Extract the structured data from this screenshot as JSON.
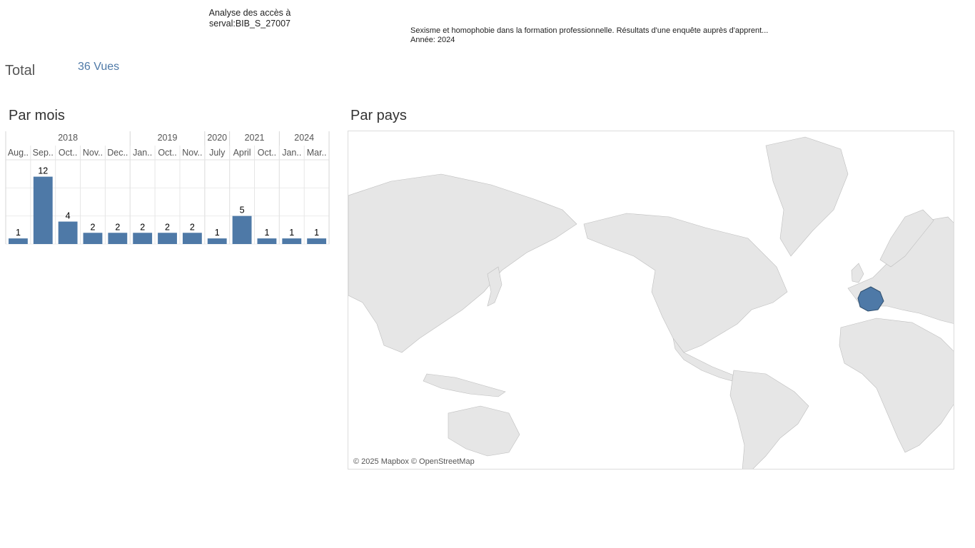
{
  "header": {
    "analysis_title_line1": "Analyse des accès à",
    "analysis_title_line2": "serval:BIB_S_27007",
    "document_title": "Sexisme et homophobie dans la formation professionnelle. Résultats d'une enquête auprès d'apprent...",
    "document_year": "Année: 2024"
  },
  "summary": {
    "total_label": "Total",
    "total_value": "36 Vues"
  },
  "sections": {
    "by_month": "Par mois",
    "by_country": "Par pays"
  },
  "chart_data": {
    "type": "bar",
    "years": [
      {
        "label": "2018",
        "months": 5
      },
      {
        "label": "2019",
        "months": 3
      },
      {
        "label": "2020",
        "months": 1
      },
      {
        "label": "2021",
        "months": 2
      },
      {
        "label": "2024",
        "months": 2
      }
    ],
    "categories": [
      "Aug..",
      "Sep..",
      "Oct..",
      "Nov..",
      "Dec..",
      "Jan..",
      "Oct..",
      "Nov..",
      "July",
      "April",
      "Oct..",
      "Jan..",
      "Mar.."
    ],
    "values": [
      1,
      12,
      4,
      2,
      2,
      2,
      2,
      2,
      1,
      5,
      1,
      1,
      1
    ],
    "ylim": [
      0,
      15
    ],
    "grid": true,
    "bar_color": "#4e79a7"
  },
  "map": {
    "attribution": "© 2025 Mapbox © OpenStreetMap",
    "highlighted_country": "France",
    "land_color": "#e6e6e6",
    "highlight_color": "#4e79a7"
  }
}
